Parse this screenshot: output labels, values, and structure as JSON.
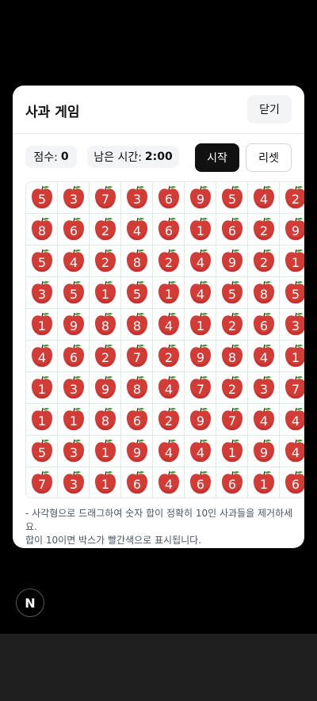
{
  "modal": {
    "title": "사과 게임",
    "close_label": "닫기"
  },
  "controls": {
    "score_label": "점수:",
    "score_value": "0",
    "time_label": "남은 시간:",
    "time_value": "2:00",
    "start_label": "시작",
    "reset_label": "리셋"
  },
  "board": {
    "rows": [
      [
        5,
        3,
        7,
        3,
        6,
        9,
        5,
        4,
        2
      ],
      [
        8,
        6,
        2,
        4,
        6,
        1,
        6,
        2,
        9
      ],
      [
        5,
        4,
        2,
        8,
        2,
        4,
        9,
        2,
        1
      ],
      [
        3,
        5,
        1,
        5,
        1,
        4,
        5,
        8,
        5
      ],
      [
        1,
        9,
        8,
        8,
        4,
        1,
        2,
        6,
        3
      ],
      [
        4,
        6,
        2,
        7,
        2,
        9,
        8,
        4,
        1
      ],
      [
        1,
        3,
        9,
        8,
        4,
        7,
        2,
        3,
        7
      ],
      [
        1,
        1,
        8,
        6,
        2,
        9,
        7,
        4,
        4
      ],
      [
        5,
        3,
        1,
        9,
        4,
        4,
        1,
        9,
        4
      ],
      [
        7,
        3,
        1,
        6,
        4,
        6,
        6,
        1,
        6
      ]
    ]
  },
  "help": {
    "line1": "- 사각형으로 드래그하여 숫자 합이 정확히 10인 사과들을 제거하세요.",
    "line2": "합이 10이면 박스가 빨간색으로 표시됩니다."
  },
  "footer": {
    "logo_letter": "N"
  },
  "colors": {
    "apple": "#d33b36",
    "apple_dark": "#b52a27",
    "leaf": "#3a9a3a",
    "grid_line": "#d8f0dc"
  }
}
